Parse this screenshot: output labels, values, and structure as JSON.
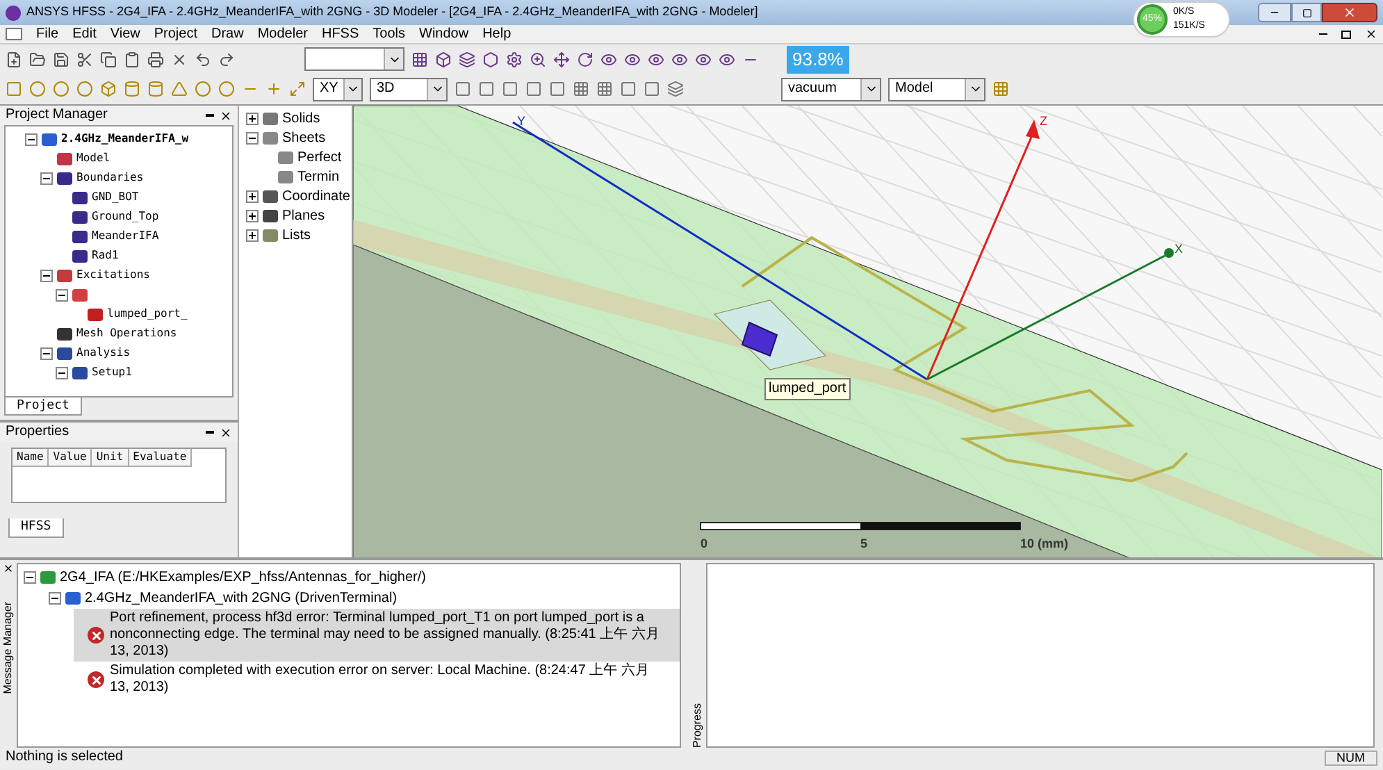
{
  "window": {
    "title": "ANSYS HFSS - 2G4_IFA - 2.4GHz_MeanderIFA_with 2GNG - 3D Modeler - [2G4_IFA - 2.4GHz_MeanderIFA_with 2GNG - Modeler]"
  },
  "network_widget": {
    "percent": "45%",
    "upload": "0K/S",
    "download": "151K/S"
  },
  "menu": [
    "File",
    "Edit",
    "View",
    "Project",
    "Draw",
    "Modeler",
    "HFSS",
    "Tools",
    "Window",
    "Help"
  ],
  "toolbar": {
    "combo_2": "XY",
    "combo_3": "3D",
    "material_combo": "vacuum",
    "mode_combo": "Model",
    "zoom_badge": "93.8%"
  },
  "project_manager": {
    "title": "Project Manager",
    "tab": "Project",
    "tree": [
      {
        "label": "2.4GHz_MeanderIFA_w",
        "kind": "design",
        "expanded": true,
        "children": [
          {
            "label": "Model",
            "kind": "model"
          },
          {
            "label": "Boundaries",
            "kind": "boundary",
            "expanded": true,
            "children": [
              {
                "label": "GND_BOT",
                "kind": "boundary"
              },
              {
                "label": "Ground_Top",
                "kind": "boundary"
              },
              {
                "label": "MeanderIFA",
                "kind": "boundary"
              },
              {
                "label": "Rad1",
                "kind": "boundary"
              }
            ]
          },
          {
            "label": "Excitations",
            "kind": "excitation",
            "expanded": true,
            "children": [
              {
                "kind": "port",
                "expanded": true,
                "children": [
                  {
                    "label": "lumped_port_",
                    "kind": "terminal"
                  }
                ]
              }
            ]
          },
          {
            "label": "Mesh Operations",
            "kind": "mesh"
          },
          {
            "label": "Analysis",
            "kind": "analysis",
            "expanded": true,
            "children": [
              {
                "label": "Setup1",
                "kind": "analysis",
                "expanded": true
              }
            ]
          }
        ]
      }
    ]
  },
  "properties": {
    "title": "Properties",
    "tab": "HFSS",
    "columns": [
      "Name",
      "Value",
      "Unit",
      "Evaluate"
    ]
  },
  "model_tree": [
    {
      "label": "Solids",
      "kind": "solid",
      "expanded": false
    },
    {
      "label": "Sheets",
      "kind": "sheet",
      "expanded": true,
      "children": [
        {
          "label": "Perfect",
          "kind": "sheet"
        },
        {
          "label": "Termin",
          "kind": "sheet"
        }
      ]
    },
    {
      "label": "Coordinate",
      "kind": "coord",
      "expanded": false
    },
    {
      "label": "Planes",
      "kind": "plane",
      "expanded": false
    },
    {
      "label": "Lists",
      "kind": "list",
      "expanded": false
    }
  ],
  "viewport": {
    "axis_z": "Z",
    "axis_x": "X",
    "axis_y": "Y",
    "port_label": "lumped_port",
    "scale_labels": [
      "0",
      "5",
      "10 (mm)"
    ]
  },
  "message_manager": {
    "side_label": "Message Manager",
    "tree": [
      {
        "label": "2G4_IFA (E:/HKExamples/EXP_hfss/Antennas_for_higher/)",
        "kind": "project",
        "expanded": true,
        "children": [
          {
            "label": "2.4GHz_MeanderIFA_with 2GNG (DrivenTerminal)",
            "kind": "design",
            "expanded": true,
            "children": [
              {
                "label": "Port refinement, process hf3d error: Terminal lumped_port_T1 on port lumped_port is a nonconnecting edge. The terminal may need to be assigned manually. (8:25:41 上午 六月 13, 2013)",
                "kind": "error",
                "selected": true
              },
              {
                "label": "Simulation completed with execution error on server: Local Machine. (8:24:47 上午 六月 13, 2013)",
                "kind": "error",
                "selected": false
              }
            ]
          }
        ]
      }
    ]
  },
  "progress": {
    "side_label": "Progress"
  },
  "status_bar": {
    "text": "Nothing is selected",
    "indicator": "NUM"
  }
}
